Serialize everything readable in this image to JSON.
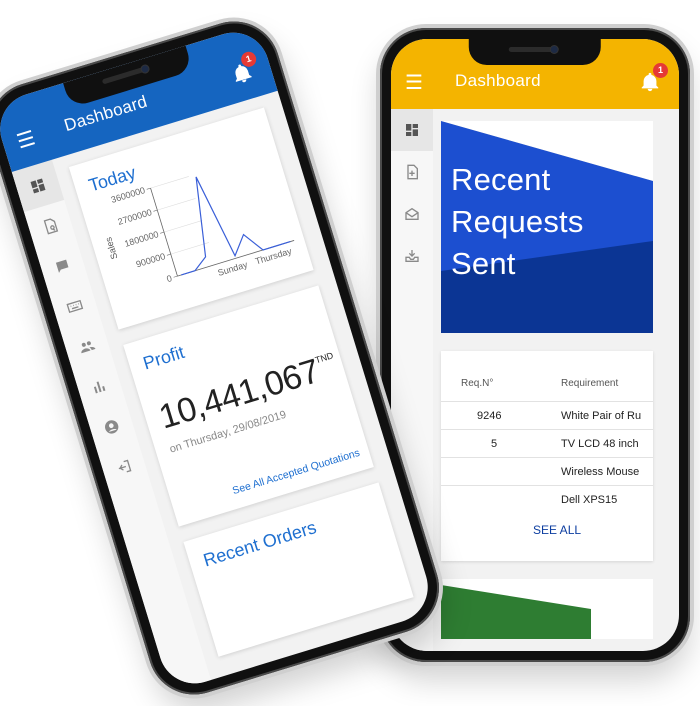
{
  "back_phone": {
    "header": {
      "title": "Dashboard",
      "notification_count": "1",
      "accent": "#f4b400"
    },
    "sidebar": {
      "items": [
        {
          "icon": "dashboard-icon",
          "active": true
        },
        {
          "icon": "document-add-icon",
          "active": false
        },
        {
          "icon": "mail-open-icon",
          "active": false
        },
        {
          "icon": "inbox-download-icon",
          "active": false
        }
      ]
    },
    "hero": {
      "line1": "Recent",
      "line2": "Requests",
      "line3": "Sent",
      "color": "#0d3ea0"
    },
    "requests": {
      "headers": {
        "req_no": "Req.N°",
        "requirement": "Requirement"
      },
      "rows": [
        {
          "req_no": "9246",
          "requirement": "White Pair of Ru"
        },
        {
          "req_no": "5",
          "requirement": "TV LCD 48 inch"
        },
        {
          "req_no": "",
          "requirement": "Wireless Mouse"
        },
        {
          "req_no": "",
          "requirement": "Dell XPS15"
        }
      ],
      "see_all": "SEE ALL"
    }
  },
  "front_phone": {
    "header": {
      "title": "Dashboard",
      "notification_count": "1",
      "accent": "#1565c0"
    },
    "sidebar": {
      "items": [
        {
          "icon": "dashboard-icon",
          "active": true
        },
        {
          "icon": "document-search-icon",
          "active": false
        },
        {
          "icon": "chat-bubble-icon",
          "active": false
        },
        {
          "icon": "keyboard-icon",
          "active": false
        },
        {
          "icon": "people-icon",
          "active": false
        },
        {
          "icon": "bar-chart-icon",
          "active": false
        },
        {
          "icon": "person-circle-icon",
          "active": false
        },
        {
          "icon": "exit-icon",
          "active": false
        }
      ]
    },
    "today": {
      "title": "Today",
      "chart_data": {
        "type": "line",
        "ylabel": "Sales",
        "y_ticks": [
          "3600000",
          "2700000",
          "1800000",
          "900000",
          "0"
        ],
        "x_ticks": [
          "Sunday",
          "Thursday"
        ],
        "ylim": [
          0,
          3600000
        ],
        "series": [
          {
            "values": [
              0,
              0,
              400000,
              3500000,
              100000,
              800000,
              0,
              0,
              0
            ]
          }
        ]
      }
    },
    "profit": {
      "title": "Profit",
      "value": "10,441,067",
      "currency": "TND",
      "date": "on Thursday, 29/08/2019",
      "link": "See All Accepted Quotations"
    },
    "orders": {
      "title": "Recent Orders"
    }
  }
}
